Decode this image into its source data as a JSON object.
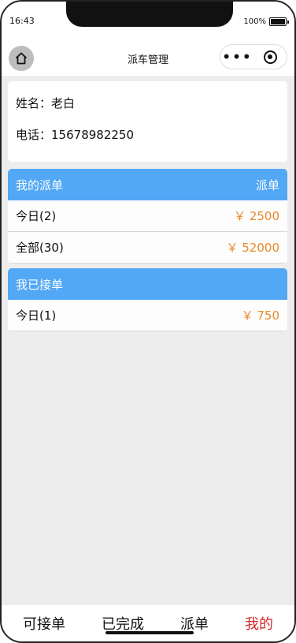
{
  "status_bar": {
    "time": "16:43",
    "battery": "100%"
  },
  "nav": {
    "title": "派车管理"
  },
  "profile": {
    "name_label": "姓名：",
    "name": "老白",
    "phone_label": "电话：",
    "phone": "15678982250"
  },
  "my_dispatch": {
    "title": "我的派单",
    "action": "派单",
    "rows": [
      {
        "label": "今日(2)",
        "amount": "￥ 2500"
      },
      {
        "label": "全部(30)",
        "amount": "￥ 52000"
      }
    ]
  },
  "my_accepted": {
    "title": "我已接单",
    "rows": [
      {
        "label": "今日(1)",
        "amount": "￥ 750"
      }
    ]
  },
  "tabs": [
    {
      "label": "可接单"
    },
    {
      "label": "已完成"
    },
    {
      "label": "派单"
    },
    {
      "label": "我的",
      "active": true
    }
  ],
  "colors": {
    "header_blue": "#52a8f5",
    "amount_orange": "#e88a2a",
    "active_tab_red": "#d42424"
  }
}
